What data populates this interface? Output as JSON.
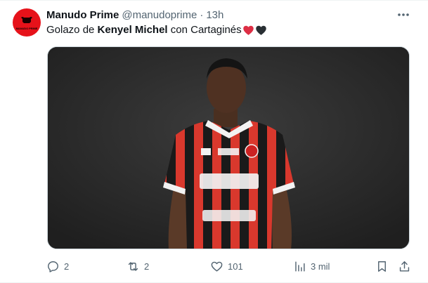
{
  "tweet": {
    "author_name": "Manudo Prime",
    "author_handle": "@manudoprime",
    "separator": "·",
    "time": "13h",
    "avatar_text": "MANUDO PRIME",
    "text_before": "Golazo de ",
    "text_bold": "Kenyel Michel",
    "text_after": " con Cartaginés",
    "emojis": [
      "red-heart",
      "black-heart"
    ],
    "media": {
      "description_icon": "player-photo",
      "jersey_sponsors": [
        "BAC",
        "kölbi",
        "medismart"
      ],
      "jersey_colors": [
        "#e03a2f",
        "#1c1c1c"
      ]
    }
  },
  "actions": {
    "replies": "2",
    "retweets": "2",
    "likes": "101",
    "views": "3 mil"
  },
  "colors": {
    "text": "#0f1419",
    "secondary": "#536471",
    "avatar_bg": "#e6121a",
    "media_bg": "#2e2e2e"
  }
}
